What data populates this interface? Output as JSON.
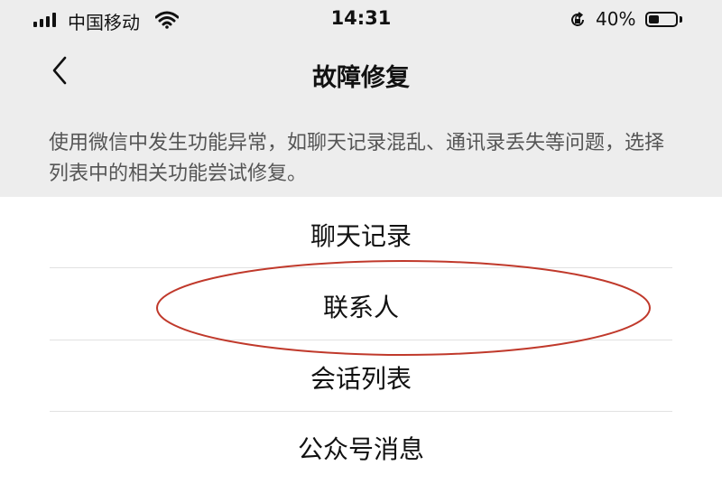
{
  "status_bar": {
    "carrier": "中国移动",
    "time": "14:31",
    "battery_percent": "40%",
    "battery_level": 0.4,
    "icons": [
      "signal-icon",
      "wifi-icon",
      "rotation-lock-icon",
      "battery-icon"
    ]
  },
  "nav": {
    "title": "故障修复",
    "back_icon": "chevron-left-icon"
  },
  "description": "使用微信中发生功能异常，如聊天记录混乱、通讯录丢失等问题，选择列表中的相关功能尝试修复。",
  "menu": {
    "items": [
      {
        "label": "聊天记录"
      },
      {
        "label": "联系人",
        "highlighted": true
      },
      {
        "label": "会话列表"
      },
      {
        "label": "公众号消息"
      }
    ]
  },
  "colors": {
    "header_bg": "#ededed",
    "annotation": "#c0392b",
    "text": "#1a1a1a",
    "secondary_text": "#555555"
  }
}
